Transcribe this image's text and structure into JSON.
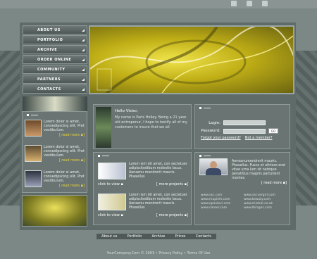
{
  "nav": {
    "items": [
      {
        "label": "ABOUT US"
      },
      {
        "label": "PORTFOLIO"
      },
      {
        "label": "ARCHIVE"
      },
      {
        "label": "ORDER ONLINE"
      },
      {
        "label": "COMMUNITY"
      },
      {
        "label": "PARTNERS"
      },
      {
        "label": "CONTACTS"
      }
    ]
  },
  "news": {
    "heading": "",
    "items": [
      {
        "text": "Lorem dolor si amet, consedipscing elit. Pret vestibulum.",
        "more": "read more"
      },
      {
        "text": "Lorem dolor si amet, consedipscing elit. Pret vestibulum.",
        "more": "read more"
      },
      {
        "text": "Lorem dolor si amet, consedipscing elit. Pret vestibulum.",
        "more": "read more"
      }
    ]
  },
  "welcome": {
    "title": "Hello Vistor,",
    "body": "My name is Paris Holley. Being a 21 year old entrepenur, I hope to testify all of my customers to insure that we all"
  },
  "login": {
    "login_label": "Login:",
    "password_label": "Password:",
    "go_label": "GO",
    "forgot_link": "Forgot your password?",
    "member_link": "Not a member?"
  },
  "projects": {
    "items": [
      {
        "text": "Lorem ism dit amet, con sectetuer adipiscitedibum molestie lacus. Aenaenu mendrerit mauris. Phasellus",
        "click": "click to view",
        "more": "more projects"
      },
      {
        "text": "Lorem ism dit amet, con sectetuer adipiscitedibum molestie lacus. Aenaenu mendrerit mauris. Phasellus",
        "click": "click to view",
        "more": "more projects"
      }
    ]
  },
  "partner": {
    "text": "Aeneanumendrerit mauris. Phasellus. Fusce et ultrices erat vitae urna lum sit natoque penatibus magnis parturient montes.",
    "more": "read more",
    "urls": [
      "www.sxc.com",
      "www.sxcvergirl.com",
      "www.mapinfo.com",
      "www.beauty.com",
      "www.openlevi.com",
      "www.mistral.co.uk",
      "www.career.com",
      "www.lbrages.com"
    ]
  },
  "footer": {
    "links": [
      "About us",
      "Portfolio",
      "Archive",
      "Prices",
      "Contacts"
    ],
    "copyright": "YourCompany.Com © 2003 • Privacy Policy • Terms Of Use"
  }
}
